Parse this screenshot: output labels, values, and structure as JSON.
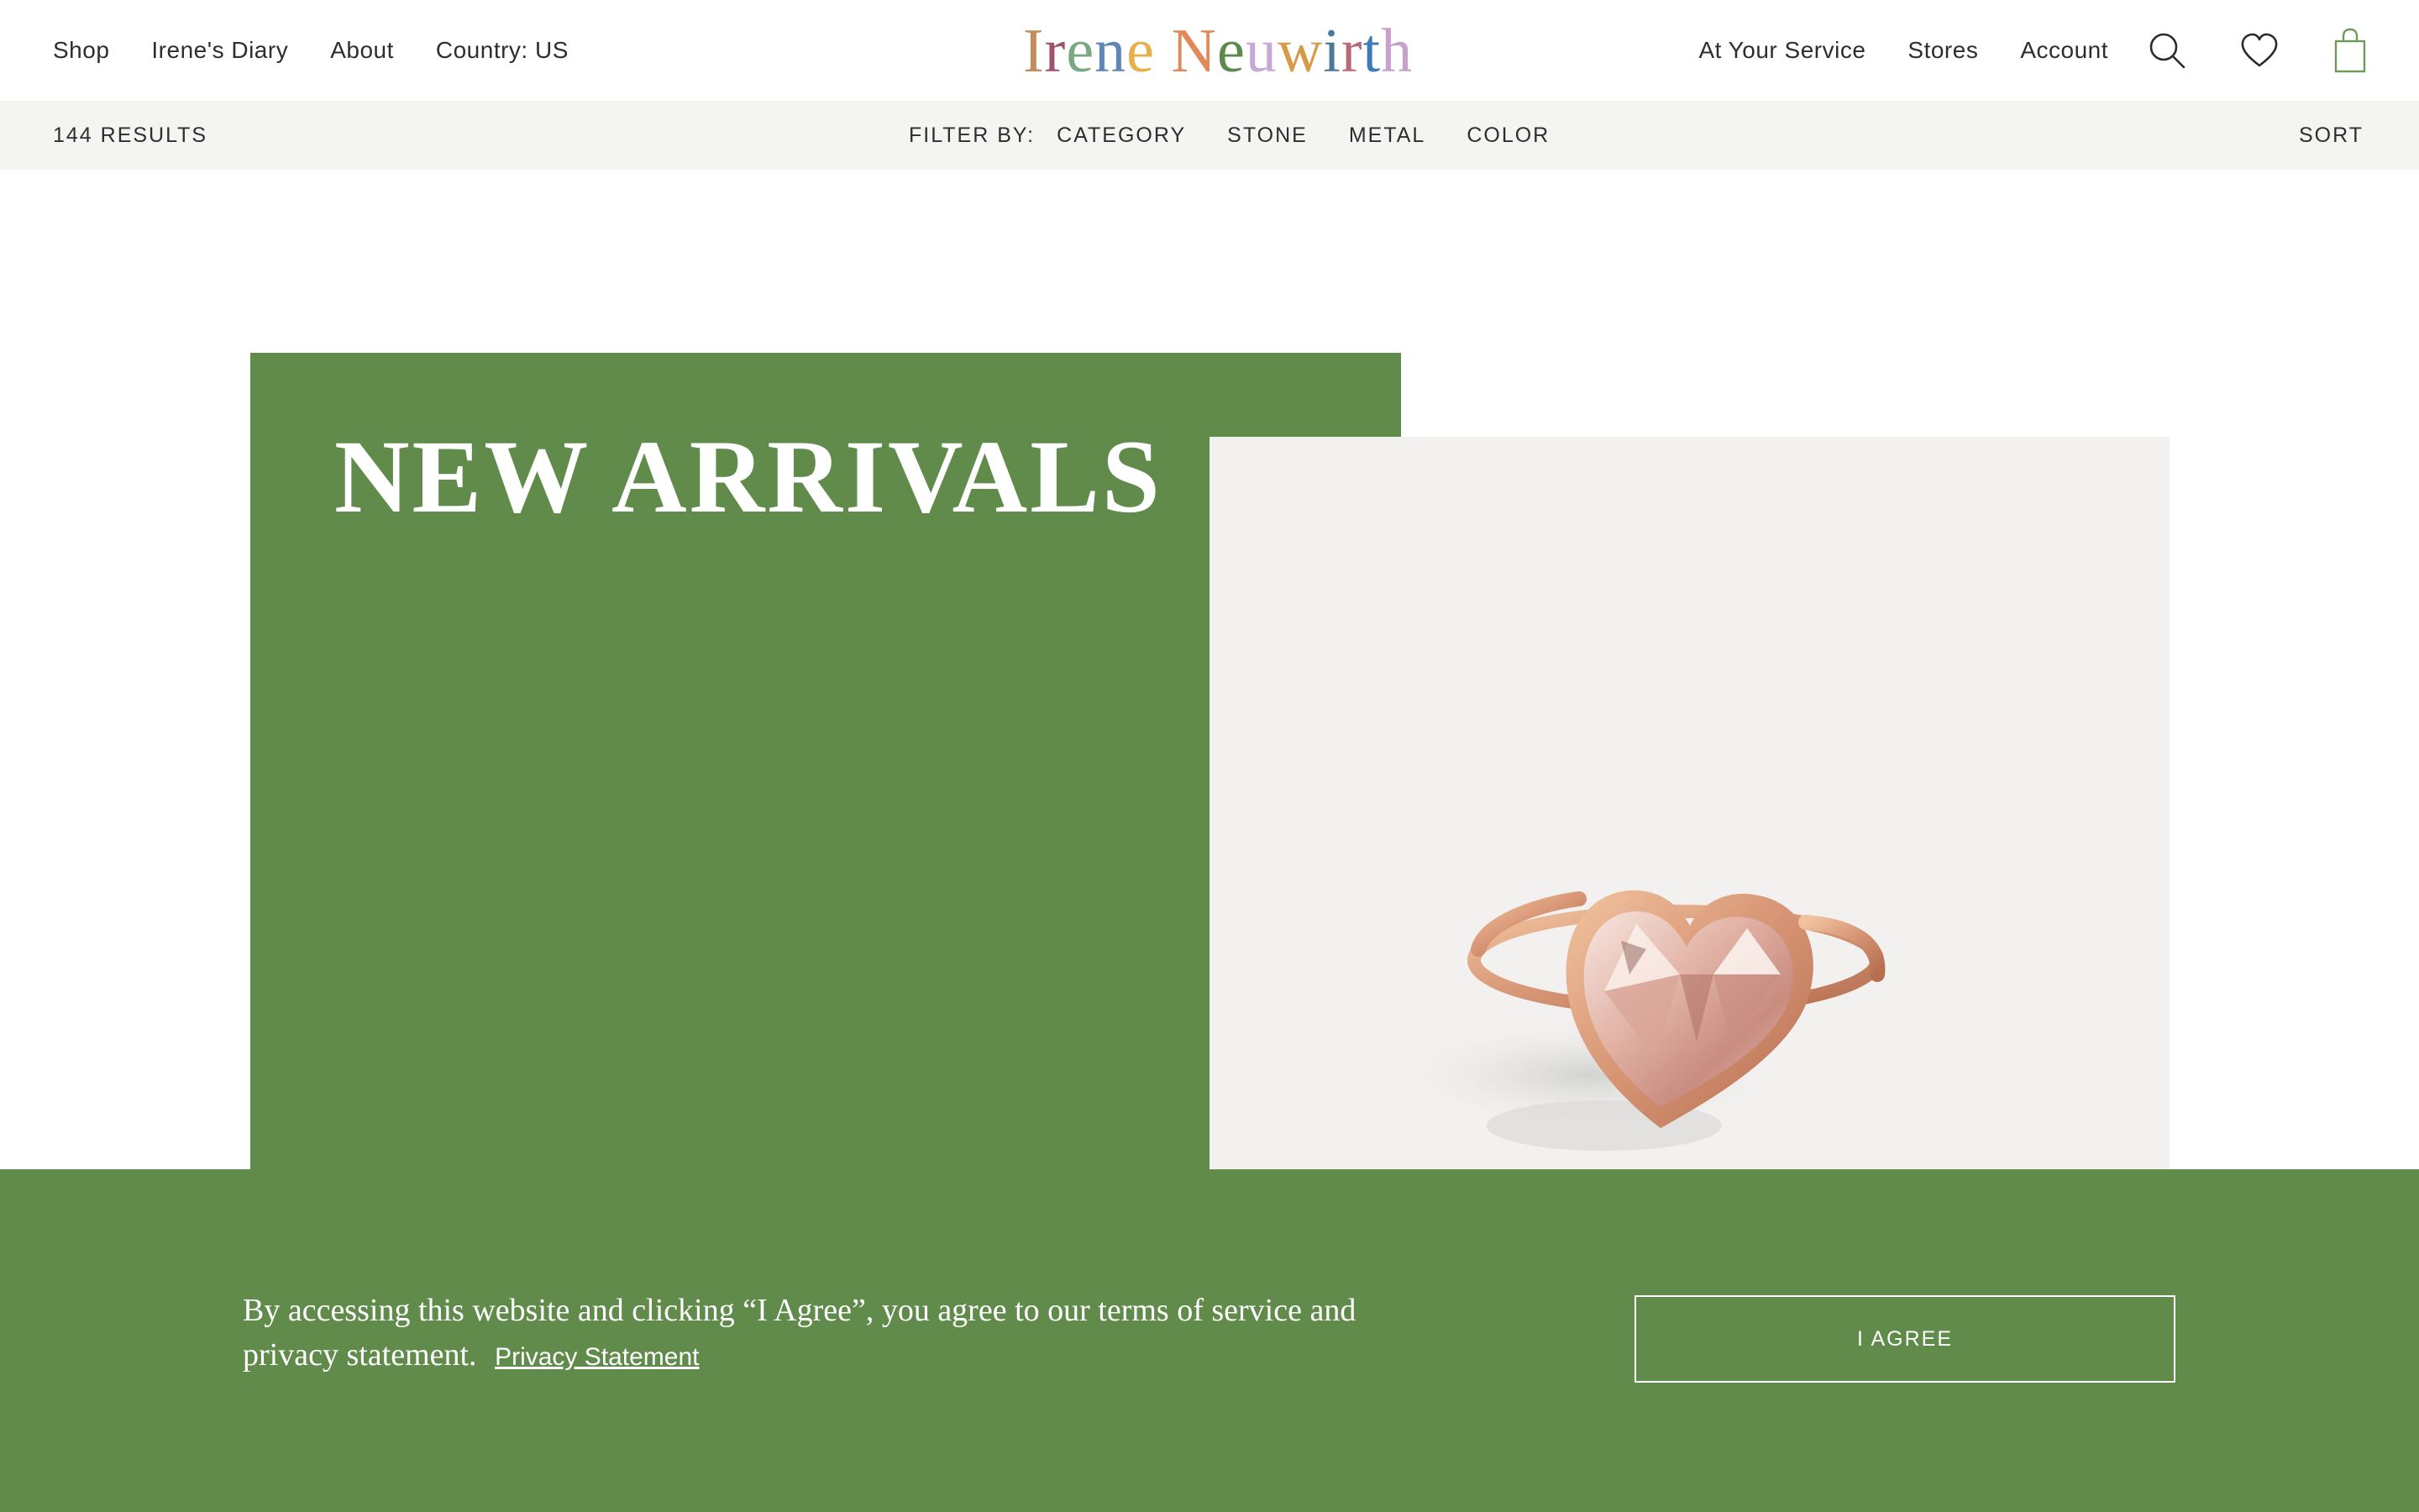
{
  "header": {
    "nav_left": [
      "Shop",
      "Irene's Diary",
      "About",
      "Country: US"
    ],
    "nav_right": [
      "At Your Service",
      "Stores",
      "Account"
    ],
    "logo": {
      "letters": [
        {
          "char": "I",
          "color": "#c58b5a"
        },
        {
          "char": "r",
          "color": "#a0526b"
        },
        {
          "char": "e",
          "color": "#7aa882"
        },
        {
          "char": "n",
          "color": "#5f86b8"
        },
        {
          "char": "e",
          "color": "#e8b04a"
        },
        {
          "char": " ",
          "color": "#ffffff"
        },
        {
          "char": "N",
          "color": "#e08a5a"
        },
        {
          "char": "e",
          "color": "#5c8a4c"
        },
        {
          "char": "u",
          "color": "#c8a8d8"
        },
        {
          "char": "w",
          "color": "#d79a4a"
        },
        {
          "char": "i",
          "color": "#4a7a9a"
        },
        {
          "char": "r",
          "color": "#b86a7a"
        },
        {
          "char": "t",
          "color": "#3e7ab8"
        },
        {
          "char": "h",
          "color": "#c7a0cc"
        }
      ]
    },
    "icons": {
      "search": "search-icon",
      "wishlist": "heart-icon",
      "cart": "shopping-bag-icon"
    }
  },
  "filter_bar": {
    "results": "144 RESULTS",
    "filter_label": "FILTER BY:",
    "filters": [
      "CATEGORY",
      "STONE",
      "METAL",
      "COLOR"
    ],
    "sort": "SORT"
  },
  "hero": {
    "title": "NEW ARRIVALS",
    "accent_color": "#608b4b"
  },
  "consent": {
    "text": "By accessing this website and clicking “I Agree”, you agree to our terms of service and privacy statement.",
    "link": "Privacy Statement",
    "button": "I AGREE"
  }
}
